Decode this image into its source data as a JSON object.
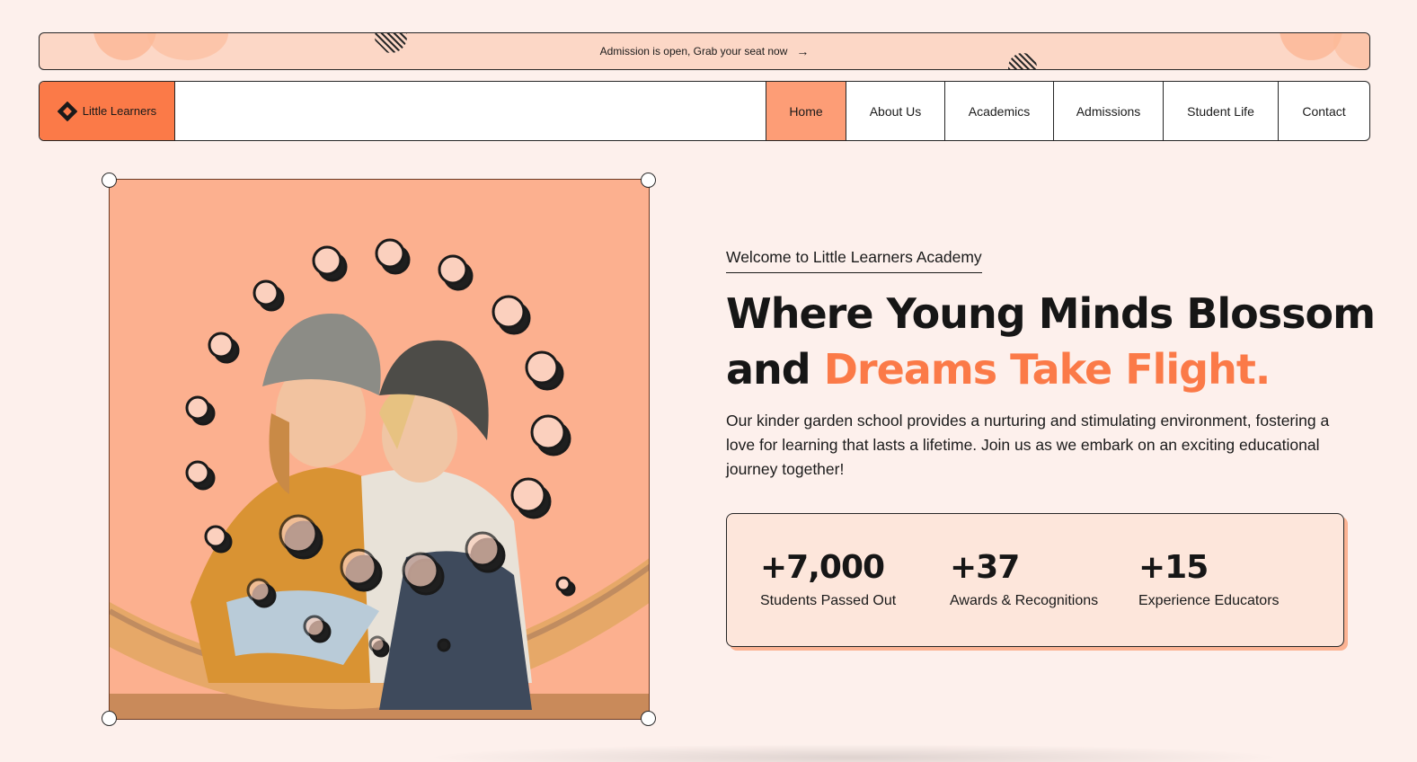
{
  "banner": {
    "text": "Admission is open, Grab your seat now",
    "arrow_icon": "arrow-right-icon"
  },
  "nav": {
    "logo_text": "Little Learners",
    "logo_icon": "diamond-logo-icon",
    "items": [
      {
        "label": "Home",
        "active": true
      },
      {
        "label": "About Us",
        "active": false
      },
      {
        "label": "Academics",
        "active": false
      },
      {
        "label": "Admissions",
        "active": false
      },
      {
        "label": "Student Life",
        "active": false
      },
      {
        "label": "Contact",
        "active": false
      }
    ]
  },
  "hero": {
    "eyebrow": "Welcome to Little Learners Academy",
    "headline_line1": "Where Young Minds Blossom",
    "headline_and": "and",
    "headline_accent": "Dreams Take Flight.",
    "description": "Our kinder garden school provides a nurturing and stimulating environment, fostering a love for learning that lasts a lifetime. Join us as we embark on an exciting educational journey together!"
  },
  "stats": [
    {
      "value": "+7,000",
      "label": "Students Passed Out"
    },
    {
      "value": "+37",
      "label": "Awards & Recognitions"
    },
    {
      "value": "+15",
      "label": "Experience Educators"
    }
  ],
  "colors": {
    "accent": "#fb7a48",
    "page_bg": "#fdf0ec",
    "banner_bg": "#fcd7c6",
    "nav_active_bg": "#fd9d76",
    "card_bg": "#fde6db",
    "image_bg": "#fcb08f"
  }
}
